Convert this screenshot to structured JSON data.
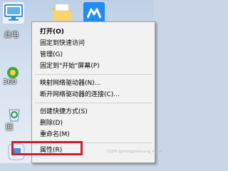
{
  "desktop": {
    "icons": [
      {
        "label": "此电"
      },
      {
        "label": "360"
      },
      {
        "label": "回"
      }
    ]
  },
  "context_menu": {
    "items": [
      {
        "label": "打开(O)"
      },
      {
        "label": "固定到快速访问"
      },
      {
        "label": "管理(G)"
      },
      {
        "label": "固定到\"开始\"屏幕(P)"
      },
      {
        "label": "映射网络驱动器(N)..."
      },
      {
        "label": "断开网络驱动器的连接(C)..."
      },
      {
        "label": "创建快捷方式(S)"
      },
      {
        "label": "删除(D)"
      },
      {
        "label": "重命名(M)"
      },
      {
        "label": "属性(R)"
      }
    ],
    "highlight_color": "#d01f2b"
  },
  "watermark": "CSDN @zhengjianhuang_home"
}
